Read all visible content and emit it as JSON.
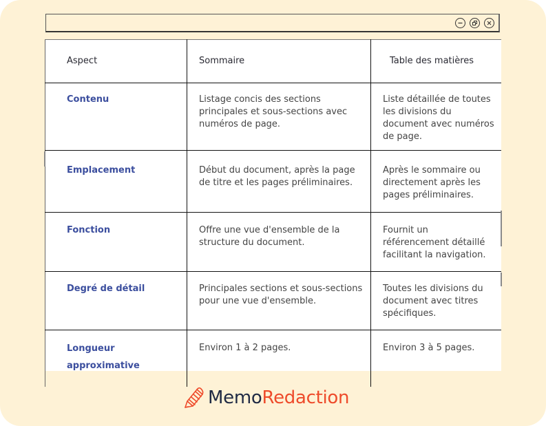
{
  "window": {
    "controls": [
      {
        "name": "minimize",
        "icon": "minimize-circle-icon"
      },
      {
        "name": "restore",
        "icon": "restore-circle-icon"
      },
      {
        "name": "close",
        "icon": "close-circle-icon"
      }
    ]
  },
  "table": {
    "headers": [
      "Aspect",
      "Sommaire",
      "Table des matières"
    ],
    "rows": [
      {
        "aspect": "Contenu",
        "sommaire": "Listage concis des sections principales et sous-sections avec numéros de page.",
        "table_des_matieres": "Liste détaillée de toutes les divisions du document avec numéros de page."
      },
      {
        "aspect": "Emplacement",
        "sommaire": "Début du document, après la page de titre et les pages préliminaires.",
        "table_des_matieres": "Après le sommaire ou directement après les pages préliminaires."
      },
      {
        "aspect": "Fonction",
        "sommaire": "Offre une vue d'ensemble de la structure du document.",
        "table_des_matieres": "Fournit un référencement détaillé facilitant la navigation."
      },
      {
        "aspect": "Degré de détail",
        "sommaire": "Principales sections et sous-sections pour une vue d'ensemble.",
        "table_des_matieres": "Toutes les divisions du document avec titres spécifiques."
      },
      {
        "aspect": "Longueur approximative",
        "sommaire": "Environ 1 à 2 pages.",
        "table_des_matieres": "Environ 3 à 5 pages."
      }
    ]
  },
  "brand": {
    "part1": "Memo",
    "part2": "Redaction",
    "icon": "pencil-notebook-icon",
    "colors": {
      "part1": "#1F2A44",
      "part2": "#EE4B2B"
    }
  },
  "colors": {
    "background": "#FEF2D6",
    "aspect_label": "#3B4E9E",
    "body_text": "#444444"
  }
}
